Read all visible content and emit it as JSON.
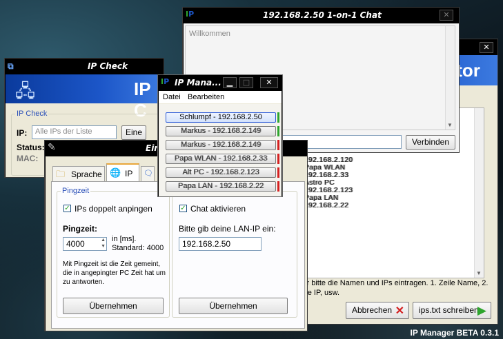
{
  "ipcheck": {
    "title": "IP Check",
    "banner": "IP C",
    "group_legend": "IP Check",
    "ip_label": "IP:",
    "ip_placeholder": "Alle IPs der Liste",
    "go_button": "Eine",
    "status_label": "Status:",
    "mac_label": "MAC:"
  },
  "chat": {
    "title": "192.168.2.50 1-on-1 Chat",
    "welcome": "Willkommen",
    "connect_button": "Verbinden"
  },
  "monitor": {
    "banner": "itor",
    "list_lines": [
      "192.168.2.120",
      "Papa WLAN",
      "192.168.2.33",
      "Astro PC",
      "192.168.2.123",
      "Papa LAN",
      "192.168.2.22"
    ],
    "hint": "Hier bitte die Namen und IPs eintragen. 1. Zeile Name, 2. Zeile IP, usw.",
    "cancel_button": "Abbrechen",
    "write_button": "ips.txt schreiben"
  },
  "ipmanager": {
    "title": "IP Mana...",
    "menu": [
      "Datei",
      "Bearbeiten"
    ],
    "entries": [
      {
        "label": "Schlumpf - 192.168.2.50",
        "status": "green",
        "selected": true
      },
      {
        "label": "Markus - 192.168.2.149",
        "status": "green"
      },
      {
        "label": "Markus - 192.168.2.149",
        "status": "red"
      },
      {
        "label": "Papa WLAN - 192.168.2.33",
        "status": "red"
      },
      {
        "label": "Alt PC - 192.168.2.123",
        "status": "red"
      },
      {
        "label": "Papa LAN - 192.168.2.22",
        "status": "red"
      }
    ]
  },
  "settings": {
    "title": "Ein",
    "tabs": [
      "Sprache",
      "IP"
    ],
    "ping_legend": "Pingzeit",
    "ping_double": "IPs doppelt anpingen",
    "ping_label": "Pingzeit:",
    "ping_value": "4000",
    "ping_unit": "in [ms].",
    "ping_standard": "Standard: 4000",
    "ping_desc": "Mit Pingzeit ist die Zeit gemeint, die in angepingter PC Zeit hat um zu antworten.",
    "apply_left": "Übernehmen",
    "chat_enable": "Chat aktivieren",
    "lan_label": "Bitte gib deine LAN-IP ein:",
    "lan_value": "192.168.2.50",
    "apply_right": "Übernehmen"
  },
  "footer": "IP Manager BETA 0.3.1",
  "colors": {
    "status_green": "#2ea52e",
    "status_red": "#d42020",
    "accent_blue": "#1c56c8"
  }
}
